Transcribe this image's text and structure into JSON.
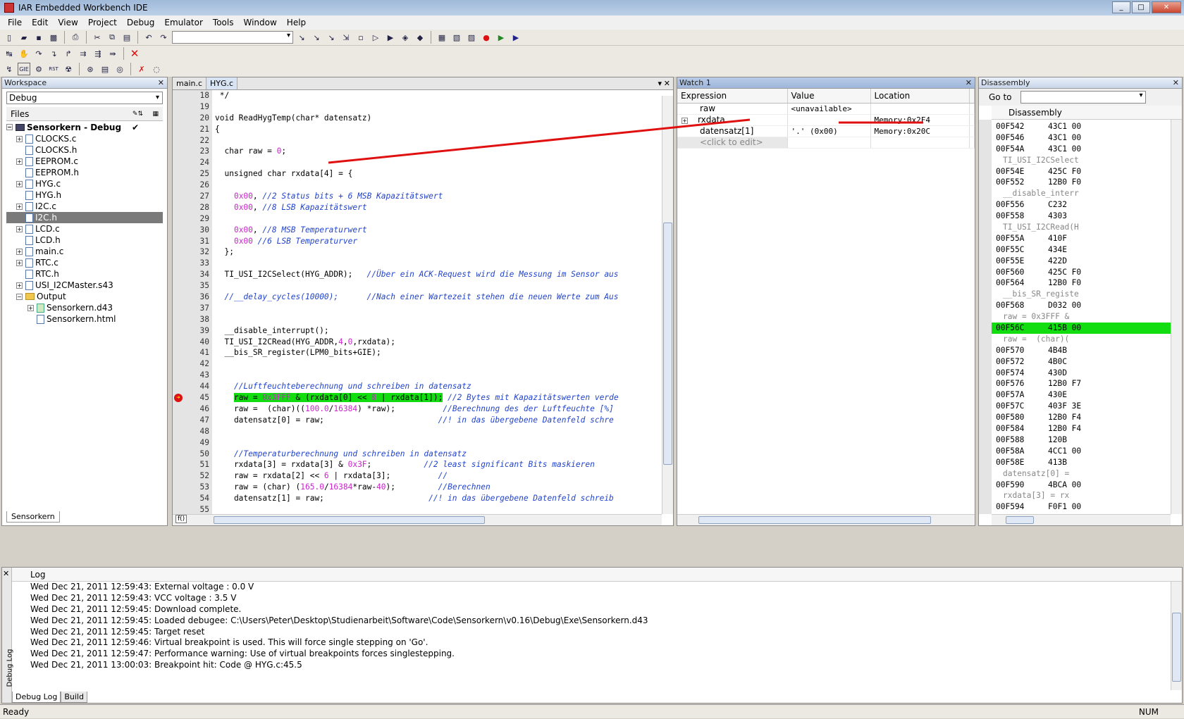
{
  "window": {
    "title": "IAR Embedded Workbench IDE",
    "min": "_",
    "max": "□",
    "close": "✕"
  },
  "menu": [
    "File",
    "Edit",
    "View",
    "Project",
    "Debug",
    "Emulator",
    "Tools",
    "Window",
    "Help"
  ],
  "workspace": {
    "panel_title": "Workspace",
    "config": "Debug",
    "files_header": "Files",
    "project": "Sensorkern - Debug",
    "check": "✔",
    "files": [
      {
        "name": "CLOCKS.c",
        "expand": "+"
      },
      {
        "name": "CLOCKS.h",
        "expand": ""
      },
      {
        "name": "EEPROM.c",
        "expand": "+"
      },
      {
        "name": "EEPROM.h",
        "expand": ""
      },
      {
        "name": "HYG.c",
        "expand": "+"
      },
      {
        "name": "HYG.h",
        "expand": ""
      },
      {
        "name": "I2C.c",
        "expand": "+"
      },
      {
        "name": "I2C.h",
        "expand": ""
      },
      {
        "name": "LCD.c",
        "expand": "+"
      },
      {
        "name": "LCD.h",
        "expand": ""
      },
      {
        "name": "main.c",
        "expand": "+"
      },
      {
        "name": "RTC.c",
        "expand": "+"
      },
      {
        "name": "RTC.h",
        "expand": ""
      },
      {
        "name": "USI_I2CMaster.s43",
        "expand": "+"
      }
    ],
    "output_folder": "Output",
    "output_files": [
      "Sensorkern.d43",
      "Sensorkern.html"
    ],
    "bottom_tab": "Sensorkern"
  },
  "editor": {
    "tabs": [
      "main.c",
      "HYG.c"
    ],
    "lines": [
      {
        "n": "18",
        "t": " */"
      },
      {
        "n": "19",
        "t": ""
      },
      {
        "n": "20",
        "t": "void ReadHygTemp(char* datensatz)"
      },
      {
        "n": "21",
        "t": "{"
      },
      {
        "n": "22",
        "t": ""
      },
      {
        "n": "23",
        "t": "  char raw = 0;"
      },
      {
        "n": "24",
        "t": ""
      },
      {
        "n": "25",
        "t": "  unsigned char rxdata[4] = {"
      },
      {
        "n": "26",
        "t": ""
      },
      {
        "n": "27",
        "t": "    0x00, ",
        "c": "//2 Status bits + 6 MSB Kapazitätswert"
      },
      {
        "n": "28",
        "t": "    0x00, ",
        "c": "//8 LSB Kapazitätswert"
      },
      {
        "n": "29",
        "t": ""
      },
      {
        "n": "30",
        "t": "    0x00, ",
        "c": "//8 MSB Temperaturwert"
      },
      {
        "n": "31",
        "t": "    0x00 ",
        "c": "//6 LSB Temperaturver"
      },
      {
        "n": "32",
        "t": "  };"
      },
      {
        "n": "33",
        "t": ""
      },
      {
        "n": "34",
        "t": "  TI_USI_I2CSelect(HYG_ADDR);   ",
        "c": "//Über ein ACK-Request wird die Messung im Sensor aus"
      },
      {
        "n": "35",
        "t": ""
      },
      {
        "n": "36",
        "t": "  ",
        "c": "//__delay_cycles(10000);      //Nach einer Wartezeit stehen die neuen Werte zum Aus"
      },
      {
        "n": "37",
        "t": ""
      },
      {
        "n": "38",
        "t": ""
      },
      {
        "n": "39",
        "t": "  __disable_interrupt();"
      },
      {
        "n": "40",
        "t": "  TI_USI_I2CRead(HYG_ADDR,4,0,rxdata);"
      },
      {
        "n": "41",
        "t": "  __bis_SR_register(LPM0_bits+GIE);"
      },
      {
        "n": "42",
        "t": ""
      },
      {
        "n": "43",
        "t": ""
      },
      {
        "n": "44",
        "t": "    ",
        "c": "//Luftfeuchteberechnung und schreiben in datensatz"
      },
      {
        "n": "45",
        "t": "    ",
        "h": "raw = 0x3FFF & (rxdata[0] << 8 | rxdata[1]);",
        "c": " //2 Bytes mit Kapazitätswerten verde"
      },
      {
        "n": "46",
        "t": "    raw =  (char)((100.0/16384) *raw);          ",
        "c": "//Berechnung des der Luftfeuchte [%]"
      },
      {
        "n": "47",
        "t": "    datensatz[0] = raw;                        ",
        "c": "//! in das übergebene Datenfeld schre"
      },
      {
        "n": "48",
        "t": ""
      },
      {
        "n": "49",
        "t": ""
      },
      {
        "n": "50",
        "t": "    ",
        "c": "//Temperaturberechnung und schreiben in datensatz"
      },
      {
        "n": "51",
        "t": "    rxdata[3] = rxdata[3] & 0x3F;           ",
        "c": "//2 least significant Bits maskieren"
      },
      {
        "n": "52",
        "t": "    raw = rxdata[2] << 6 | rxdata[3];          ",
        "c": "//"
      },
      {
        "n": "53",
        "t": "    raw = (char) (165.0/16384*raw-40);         ",
        "c": "//Berechnen"
      },
      {
        "n": "54",
        "t": "    datensatz[1] = raw;                      ",
        "c": "//! in das übergebene Datenfeld schreib"
      },
      {
        "n": "55",
        "t": ""
      }
    ],
    "fn_label": "f()"
  },
  "watch": {
    "panel_title": "Watch 1",
    "columns": [
      "Expression",
      "Value",
      "Location"
    ],
    "rows": [
      {
        "expr": "raw",
        "value": "<unavailable>",
        "loc": "",
        "expand": ""
      },
      {
        "expr": "rxdata",
        "value": "",
        "loc": "Memory:0x2F4",
        "expand": "+"
      },
      {
        "expr": "datensatz[1]",
        "value": "'.' (0x00)",
        "loc": "Memory:0x20C",
        "expand": ""
      }
    ],
    "placeholder": "<click to edit>"
  },
  "disassembly": {
    "panel_title": "Disassembly",
    "goto_label": "Go to",
    "header": "Disassembly",
    "rows": [
      {
        "a": "00F542",
        "b": "43C1 00"
      },
      {
        "a": "00F546",
        "b": "43C1 00"
      },
      {
        "a": "00F54A",
        "b": "43C1 00"
      },
      {
        "src": "TI_USI_I2CSelect"
      },
      {
        "a": "00F54E",
        "b": "425C F0"
      },
      {
        "a": "00F552",
        "b": "12B0 F0"
      },
      {
        "src": "__disable_interr"
      },
      {
        "a": "00F556",
        "b": "C232"
      },
      {
        "a": "00F558",
        "b": "4303"
      },
      {
        "src": "TI_USI_I2CRead(H"
      },
      {
        "a": "00F55A",
        "b": "410F"
      },
      {
        "a": "00F55C",
        "b": "434E"
      },
      {
        "a": "00F55E",
        "b": "422D"
      },
      {
        "a": "00F560",
        "b": "425C F0"
      },
      {
        "a": "00F564",
        "b": "12B0 F0"
      },
      {
        "src": "__bis_SR_registe"
      },
      {
        "a": "00F568",
        "b": "D032 00"
      },
      {
        "src": "raw = 0x3FFF &"
      },
      {
        "a": "00F56C",
        "b": "415B 00",
        "current": true
      },
      {
        "src": "raw =  (char)("
      },
      {
        "a": "00F570",
        "b": "4B4B"
      },
      {
        "a": "00F572",
        "b": "4B0C"
      },
      {
        "a": "00F574",
        "b": "430D"
      },
      {
        "a": "00F576",
        "b": "12B0 F7"
      },
      {
        "a": "00F57A",
        "b": "430E"
      },
      {
        "a": "00F57C",
        "b": "403F 3E"
      },
      {
        "a": "00F580",
        "b": "12B0 F4"
      },
      {
        "a": "00F584",
        "b": "12B0 F4"
      },
      {
        "a": "00F588",
        "b": "120B"
      },
      {
        "a": "00F58A",
        "b": "4CC1 00"
      },
      {
        "a": "00F58E",
        "b": "413B"
      },
      {
        "src": "datensatz[0] ="
      },
      {
        "a": "00F590",
        "b": "4BCA 00"
      },
      {
        "src": "rxdata[3] = rx"
      },
      {
        "a": "00F594",
        "b": "F0F1 00"
      }
    ]
  },
  "log": {
    "header": "Log",
    "side_label": "Debug Log",
    "entries": [
      "Wed Dec 21, 2011 12:59:43: External voltage : 0.0 V",
      "Wed Dec 21, 2011 12:59:43: VCC voltage : 3.5 V",
      "Wed Dec 21, 2011 12:59:45: Download complete.",
      "Wed Dec 21, 2011 12:59:45: Loaded debugee: C:\\Users\\Peter\\Desktop\\Studienarbeit\\Software\\Code\\Sensorkern\\v0.16\\Debug\\Exe\\Sensorkern.d43",
      "Wed Dec 21, 2011 12:59:45: Target reset",
      "Wed Dec 21, 2011 12:59:46: Virtual breakpoint is used. This will force single stepping on 'Go'.",
      "Wed Dec 21, 2011 12:59:47: Performance warning: Use of virtual breakpoints forces singlestepping.",
      "Wed Dec 21, 2011 13:00:03: Breakpoint hit: Code @ HYG.c:45.5"
    ],
    "tabs": [
      "Debug Log",
      "Build"
    ]
  },
  "status": {
    "left": "Ready",
    "right": "NUM"
  },
  "colors": {
    "highlight": "#11dd11",
    "annotation": "#e01010",
    "breakpoint": "#dd1111"
  }
}
